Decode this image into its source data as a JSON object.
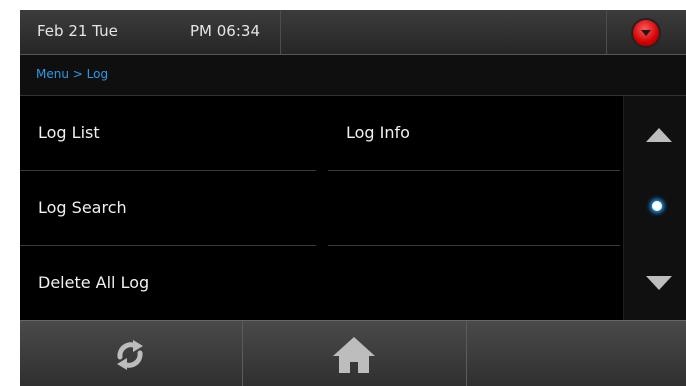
{
  "status_bar": {
    "date": "Feb 21 Tue",
    "time": "PM 06:34",
    "alert_color": "#d10000"
  },
  "breadcrumb": "Menu > Log",
  "menu": {
    "items": [
      {
        "label": "Log List"
      },
      {
        "label": "Log Info"
      },
      {
        "label": "Log Search"
      },
      {
        "label": ""
      },
      {
        "label": "Delete All Log"
      },
      {
        "label": ""
      }
    ]
  },
  "scroll": {
    "up_icon": "triangle-up-icon",
    "page_indicator_icon": "page-dot-icon",
    "down_icon": "triangle-down-icon",
    "accent_color": "#1aa0ff"
  },
  "bottom_bar": {
    "buttons": [
      {
        "icon": "refresh-icon"
      },
      {
        "icon": "home-icon"
      },
      {
        "icon": ""
      }
    ]
  }
}
